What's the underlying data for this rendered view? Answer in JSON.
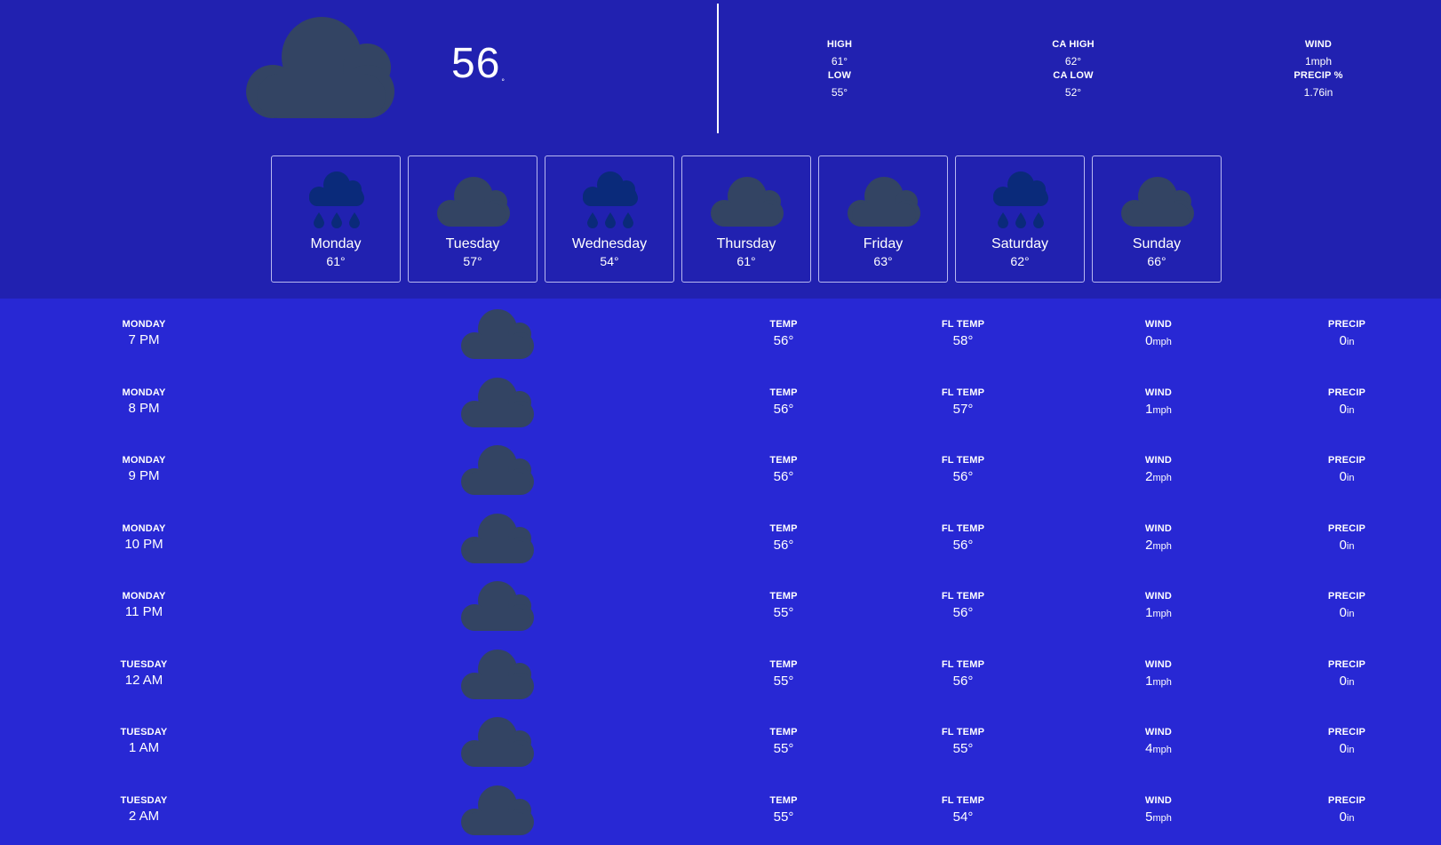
{
  "current": {
    "temperature": "56",
    "degree_symbol": "°",
    "condition_icon": "cloud-icon",
    "stats": {
      "high_label": "HIGH",
      "high_value": "61°",
      "low_label": "LOW",
      "low_value": "55°",
      "ca_high_label": "CA HIGH",
      "ca_high_value": "62°",
      "ca_low_label": "CA LOW",
      "ca_low_value": "52°",
      "wind_label": "WIND",
      "wind_value": "1mph",
      "precip_label": "PRECIP %",
      "precip_value": "1.76in"
    }
  },
  "colors": {
    "header_bg": "#2121b0",
    "body_bg": "#2828d4",
    "cloud": "#334463",
    "rain_cloud": "#0a2a7a"
  },
  "daily": [
    {
      "day": "Monday",
      "temp": "61°",
      "icon": "rain-cloud-icon"
    },
    {
      "day": "Tuesday",
      "temp": "57°",
      "icon": "cloud-icon"
    },
    {
      "day": "Wednesday",
      "temp": "54°",
      "icon": "rain-cloud-icon"
    },
    {
      "day": "Thursday",
      "temp": "61°",
      "icon": "cloud-icon"
    },
    {
      "day": "Friday",
      "temp": "63°",
      "icon": "cloud-icon"
    },
    {
      "day": "Saturday",
      "temp": "62°",
      "icon": "rain-cloud-icon"
    },
    {
      "day": "Sunday",
      "temp": "66°",
      "icon": "cloud-icon"
    }
  ],
  "hourly_labels": {
    "temp": "TEMP",
    "fl_temp": "FL TEMP",
    "wind": "WIND",
    "precip": "PRECIP",
    "wind_unit": "mph",
    "precip_unit": "in"
  },
  "hourly": [
    {
      "day": "MONDAY",
      "time": "7 PM",
      "icon": "cloud-icon",
      "temp": "56°",
      "fl_temp": "58°",
      "wind": "0",
      "precip": "0"
    },
    {
      "day": "MONDAY",
      "time": "8 PM",
      "icon": "cloud-icon",
      "temp": "56°",
      "fl_temp": "57°",
      "wind": "1",
      "precip": "0"
    },
    {
      "day": "MONDAY",
      "time": "9 PM",
      "icon": "cloud-icon",
      "temp": "56°",
      "fl_temp": "56°",
      "wind": "2",
      "precip": "0"
    },
    {
      "day": "MONDAY",
      "time": "10 PM",
      "icon": "cloud-icon",
      "temp": "56°",
      "fl_temp": "56°",
      "wind": "2",
      "precip": "0"
    },
    {
      "day": "MONDAY",
      "time": "11 PM",
      "icon": "cloud-icon",
      "temp": "55°",
      "fl_temp": "56°",
      "wind": "1",
      "precip": "0"
    },
    {
      "day": "TUESDAY",
      "time": "12 AM",
      "icon": "cloud-icon",
      "temp": "55°",
      "fl_temp": "56°",
      "wind": "1",
      "precip": "0"
    },
    {
      "day": "TUESDAY",
      "time": "1 AM",
      "icon": "cloud-icon",
      "temp": "55°",
      "fl_temp": "55°",
      "wind": "4",
      "precip": "0"
    },
    {
      "day": "TUESDAY",
      "time": "2 AM",
      "icon": "cloud-icon",
      "temp": "55°",
      "fl_temp": "54°",
      "wind": "5",
      "precip": "0"
    }
  ]
}
